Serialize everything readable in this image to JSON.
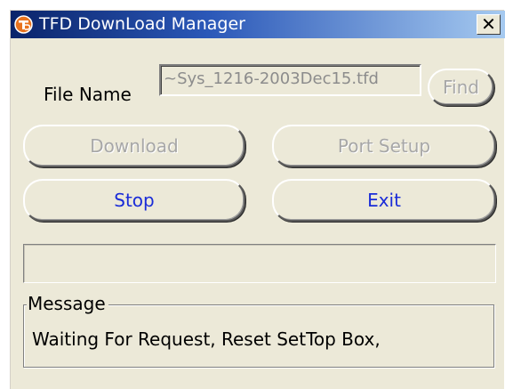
{
  "window": {
    "title": "TFD DownLoad Manager",
    "close_glyph": "✕",
    "icon": "tfd-logo-icon"
  },
  "file": {
    "label": "File Name",
    "value": "~Sys_1216-2003Dec15.tfd",
    "find_label": "Find"
  },
  "buttons": {
    "download": "Download",
    "port_setup": "Port Setup",
    "stop": "Stop",
    "exit": "Exit"
  },
  "progress": {
    "value": 0
  },
  "message": {
    "title": "Message",
    "text": "Waiting For Request, Reset SetTop Box,"
  },
  "colors": {
    "title_bar_start": "#0a246a",
    "title_bar_end": "#a6caf0",
    "enabled_text": "#1a2cd8",
    "disabled_text": "#a7a7a7",
    "window_bg": "#ece9d8"
  }
}
